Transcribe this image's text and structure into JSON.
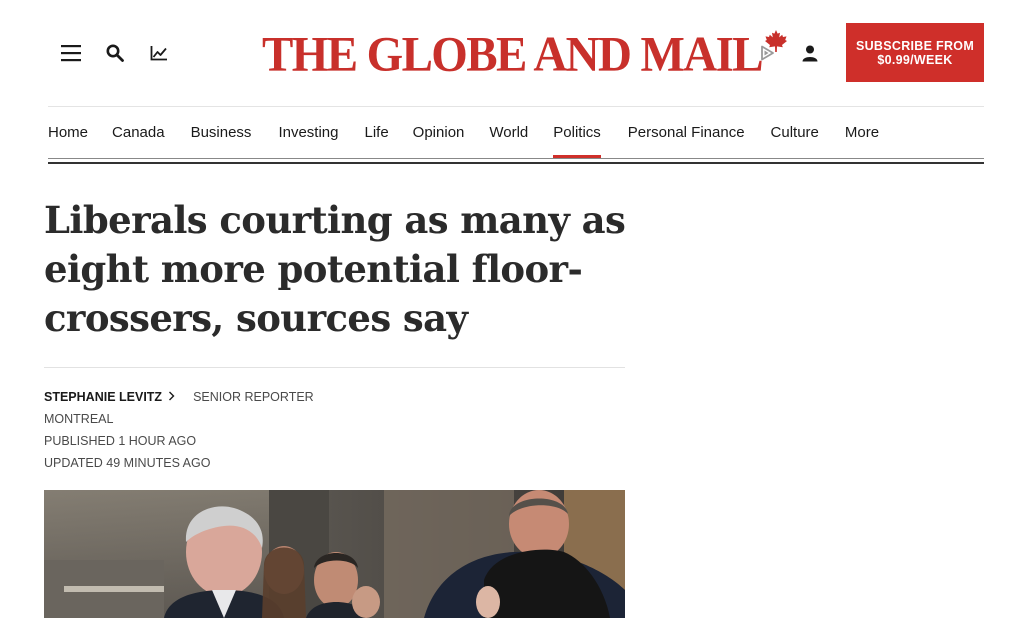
{
  "header": {
    "logo_text": "THE GLOBE AND MAIL",
    "subscribe_label": "SUBSCRIBE FROM $0.99/WEEK",
    "icons": [
      "menu-icon",
      "search-icon",
      "chart-icon",
      "listen-play-icon",
      "account-icon"
    ]
  },
  "nav": {
    "items": [
      {
        "label": "Home"
      },
      {
        "label": "Canada"
      },
      {
        "label": "Business"
      },
      {
        "label": "Investing"
      },
      {
        "label": "Life"
      },
      {
        "label": "Opinion"
      },
      {
        "label": "World"
      },
      {
        "label": "Politics",
        "active": true
      },
      {
        "label": "Personal Finance"
      },
      {
        "label": "Culture"
      },
      {
        "label": "More"
      }
    ]
  },
  "article": {
    "headline": "Liberals courting as many as eight more potential floor-crossers, sources say",
    "author": "STEPHANIE LEVITZ",
    "role": "SENIOR REPORTER",
    "location": "MONTREAL",
    "published": "PUBLISHED 1 HOUR AGO",
    "updated": "UPDATED 49 MINUTES AGO"
  },
  "colors": {
    "brand_red": "#cf2f2a",
    "text": "#1a1a1a"
  }
}
